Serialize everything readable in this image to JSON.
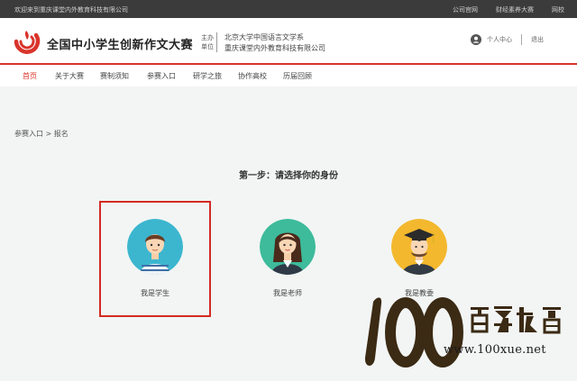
{
  "topbar": {
    "welcome": "欢迎来到重庆课堂内外教育科技有限公司",
    "links": [
      "公司官网",
      "财经素养大赛",
      "网校"
    ]
  },
  "header": {
    "brand": "全国中小学生创新作文大赛",
    "organizer_label": "主办单位",
    "organizers": [
      "北京大学中国语言文学系",
      "重庆课堂内外教育科技有限公司"
    ],
    "user_center": "个人中心",
    "logout": "退出"
  },
  "nav": {
    "items": [
      "首页",
      "关于大赛",
      "赛制须知",
      "参赛入口",
      "研学之旅",
      "协作高校",
      "历届回顾"
    ],
    "active_index": 0
  },
  "breadcrumb": "参赛入口 > 报名",
  "step_title": "第一步：请选择你的身份",
  "roles": [
    {
      "label": "我是学生",
      "selected": true
    },
    {
      "label": "我是老师",
      "selected": false
    },
    {
      "label": "我是教委",
      "selected": false
    }
  ],
  "watermark": {
    "url": "www.100xue.net"
  },
  "colors": {
    "accent": "#d9342b",
    "topbar": "#3b3b3b",
    "student_bg": "#3cb6cf",
    "teacher_bg": "#3dbb9b",
    "official_bg": "#f3b82d"
  }
}
